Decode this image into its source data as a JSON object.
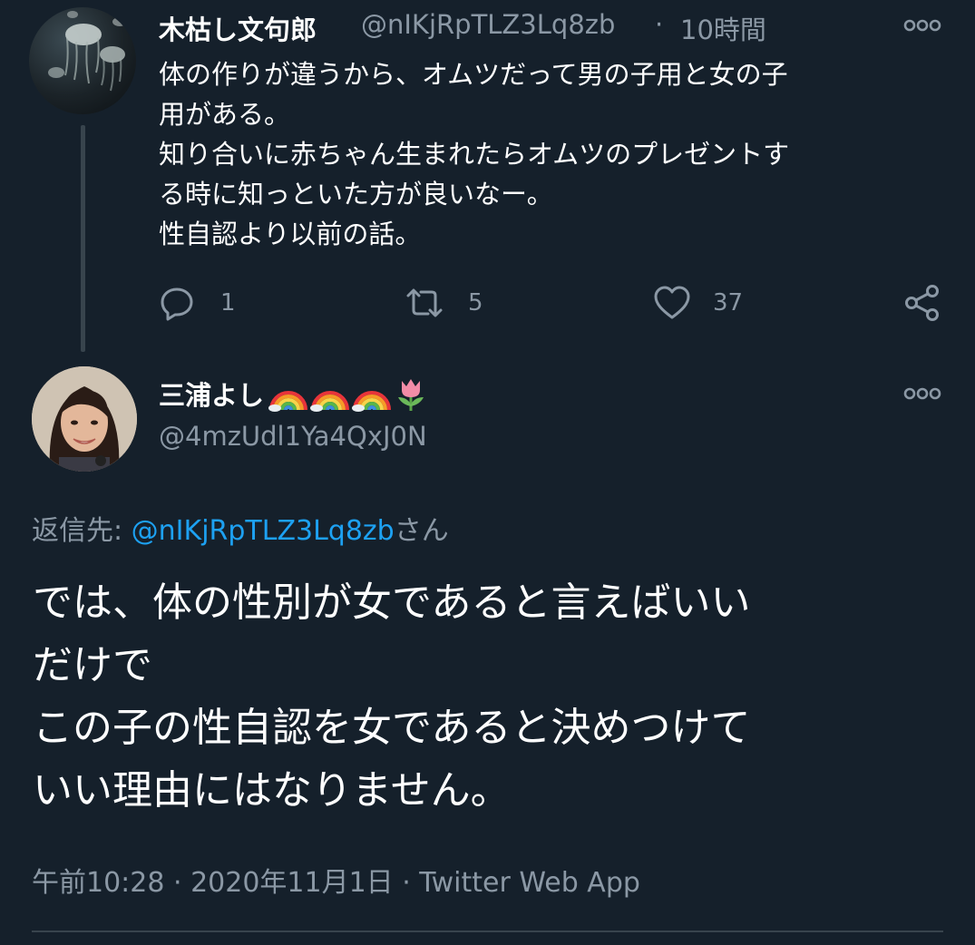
{
  "parent_tweet": {
    "author_name": "木枯し文句郎",
    "author_handle": "@nIKjRpTLZ3Lq8zb",
    "separator": "·",
    "time_ago": "10時間",
    "body_lines": [
      "体の作りが違うから、オムツだって男の子用と女の子",
      "用がある。",
      "知り合いに赤ちゃん生まれたらオムツのプレゼントす",
      "る時に知っといた方が良いなー。",
      "性自認より以前の話。"
    ],
    "actions": {
      "reply_count": "1",
      "retweet_count": "5",
      "like_count": "37"
    }
  },
  "main_tweet": {
    "author_name": "三浦よし",
    "author_handle": "@4mzUdl1Ya4QxJ0N",
    "reply_to_label": "返信先: ",
    "reply_to_handle": "@nIKjRpTLZ3Lq8zb",
    "reply_to_suffix": "さん",
    "body_lines": [
      "では、体の性別が女であると言えばいい",
      "だけで",
      "この子の性自認を女であると決めつけて",
      "いい理由にはなりません。"
    ],
    "timestamp": "午前10:28 · 2020年11月1日 · Twitter Web App"
  },
  "icons": [
    "more-icon",
    "reply-icon",
    "retweet-icon",
    "like-icon",
    "share-icon",
    "rainbow-icon",
    "tulip-icon"
  ],
  "colors": {
    "background": "#15202b",
    "secondary_text": "#8b98a5",
    "link": "#1da1f2",
    "divider": "#38444d"
  }
}
